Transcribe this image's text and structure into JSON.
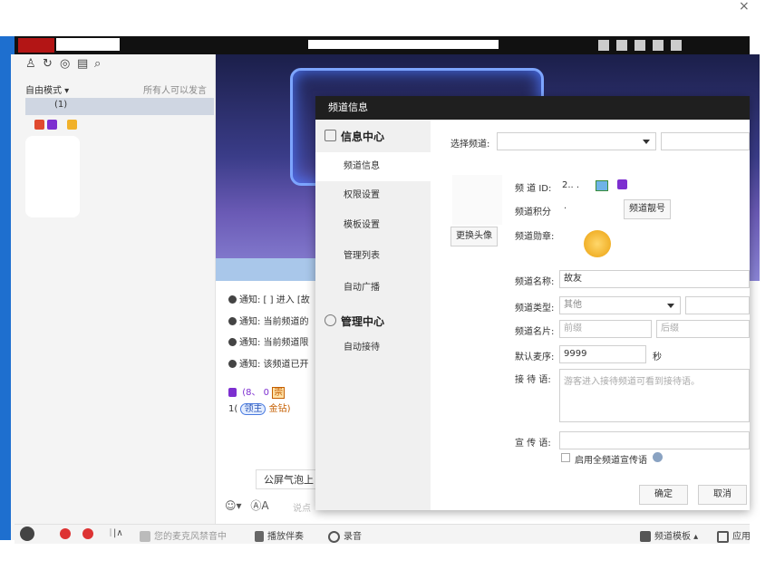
{
  "window": {
    "close_glyph": "×"
  },
  "left_panel": {
    "icons": [
      "user-icon",
      "refresh-icon",
      "location-icon",
      "notice-icon",
      "search-icon"
    ],
    "icon_glyphs": [
      "♙",
      "↻",
      "◎",
      "▤",
      "⌕"
    ],
    "mode_label": "自由模式 ▾",
    "anyone_label": "所有人可以发言",
    "channel_text": "(1)"
  },
  "notices": [
    "通知: [ ] 进入 [故",
    "通知: 当前频道的",
    "通知: 当前频道限",
    "通知: 该频道已开"
  ],
  "chat": {
    "user_line_1": "(8、  0",
    "user_line_1_tag": "崇",
    "user_line_2_prefix": "1(",
    "user_line_2_badge": "领主",
    "user_line_2_suffix": "金钻)",
    "bubble_text": "公屏气泡上",
    "say_placeholder": "说点",
    "emoji_glyph": "☺▾",
    "font_glyph": "ⒶA"
  },
  "bottombar": {
    "mic_muted_text": "您的麦克风禁音中",
    "play_accompaniment": "播放伴奏",
    "record": "录音",
    "channel_template": "频道模板 ▴",
    "apps": "应用"
  },
  "dialog": {
    "title": "频道信息",
    "nav": {
      "info_center": "信息中心",
      "items_info": [
        "频道信息",
        "权限设置",
        "模板设置",
        "管理列表",
        "自动广播"
      ],
      "manage_center": "管理中心",
      "items_manage": [
        "自动接待"
      ]
    },
    "form": {
      "select_channel_label": "选择频道:",
      "channel_id_label": "频 道 ID:",
      "channel_id_value": "2.. .",
      "channel_points_label": "频道积分",
      "channel_points_value": "·",
      "channel_pretty_btn": "频道靓号",
      "change_avatar_btn": "更换头像",
      "channel_medal_label": "频道勋章:",
      "channel_name_label": "频道名称:",
      "channel_name_value": "故友",
      "channel_type_label": "频道类型:",
      "channel_type_value": "其他",
      "channel_card_label": "频道名片:",
      "prefix_placeholder": "前缀",
      "suffix_placeholder": "后缀",
      "default_mic_label": "默认麦序:",
      "default_mic_value": "9999",
      "default_mic_unit": "秒",
      "reception_label": "接 待 语:",
      "reception_placeholder": "游客进入接待频道可看到接待语。",
      "promo_label": "宣 传 语:",
      "promo_all_label": "启用全频道宣传语",
      "ok_btn": "确定",
      "cancel_btn": "取消"
    }
  },
  "colors": {
    "titlebar": "#1f1f1f",
    "left_accent": "#1e6fcf",
    "selected_row": "#cfd6e2",
    "badge_purple": "#7d2fd0",
    "medal_gold": "#f1b12a"
  }
}
